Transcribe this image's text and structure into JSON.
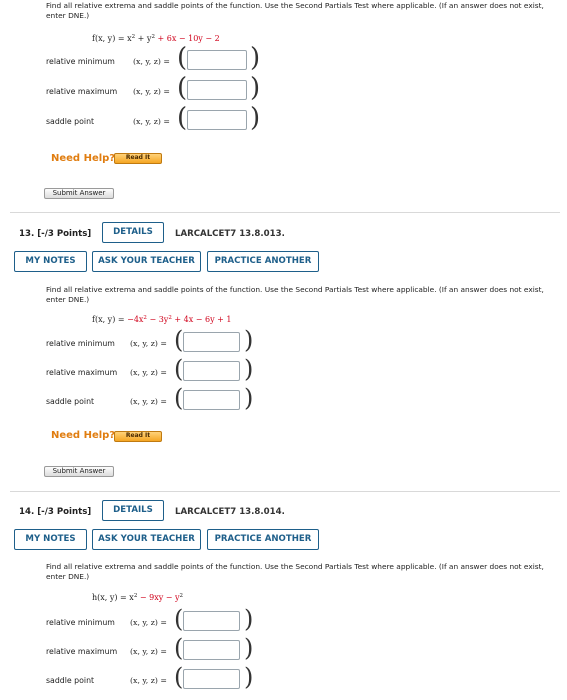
{
  "q12": {
    "prompt": "Find all relative extrema and saddle points of the function. Use the Second Partials Test where applicable. (If an answer does not exist, enter DNE.)",
    "fn_prefix": "f(x, y) = x",
    "fn_mid": " + y",
    "fn_sup": "2",
    "fn_tail": " + 6x − 10y − 2",
    "rows": [
      {
        "label": "relative minimum",
        "xyz": "(x, y, z) ="
      },
      {
        "label": "relative maximum",
        "xyz": "(x, y, z) ="
      },
      {
        "label": "saddle point",
        "xyz": "(x, y, z) ="
      }
    ],
    "need_help": "Need Help?",
    "read_it": "Read It",
    "submit": "Submit Answer"
  },
  "q13": {
    "header": "13.  [-/3 Points]",
    "details": "DETAILS",
    "code": "LARCALCET7 13.8.013.",
    "my_notes": "MY NOTES",
    "ask_teacher": "ASK YOUR TEACHER",
    "practice": "PRACTICE ANOTHER",
    "prompt": "Find all relative extrema and saddle points of the function. Use the Second Partials Test where applicable. (If an answer does not exist, enter DNE.)",
    "fn_lhs": "f(x, y) = ",
    "fn_a": "−4x",
    "fn_b": " − 3y",
    "fn_c": " + 4x − 6y + 1",
    "fn_sup": "2",
    "rows": [
      {
        "label": "relative minimum",
        "xyz": "(x, y, z) ="
      },
      {
        "label": "relative maximum",
        "xyz": "(x, y, z) ="
      },
      {
        "label": "saddle point",
        "xyz": "(x, y, z) ="
      }
    ],
    "need_help": "Need Help?",
    "read_it": "Read It",
    "submit": "Submit Answer"
  },
  "q14": {
    "header": "14.  [-/3 Points]",
    "details": "DETAILS",
    "code": "LARCALCET7 13.8.014.",
    "my_notes": "MY NOTES",
    "ask_teacher": "ASK YOUR TEACHER",
    "practice": "PRACTICE ANOTHER",
    "prompt": "Find all relative extrema and saddle points of the function. Use the Second Partials Test where applicable. (If an answer does not exist, enter DNE.)",
    "fn_lhs": "h(x, y) = x",
    "fn_mid": " − 9xy − y",
    "fn_sup": "2",
    "rows": [
      {
        "label": "relative minimum",
        "xyz": "(x, y, z) ="
      },
      {
        "label": "relative maximum",
        "xyz": "(x, y, z) ="
      },
      {
        "label": "saddle point",
        "xyz": "(x, y, z) ="
      }
    ]
  }
}
